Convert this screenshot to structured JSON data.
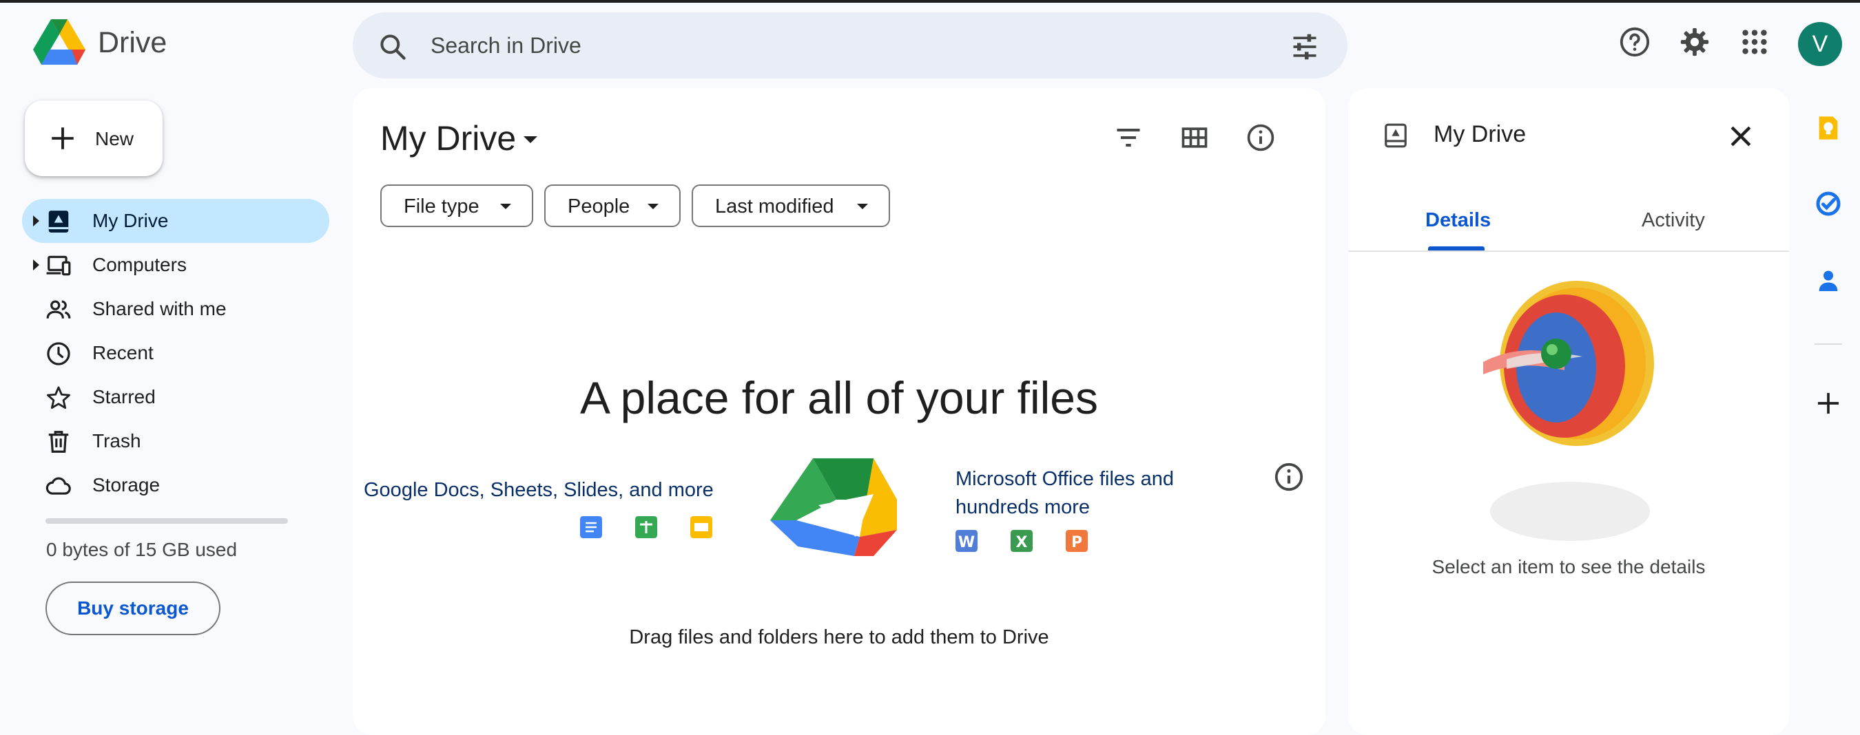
{
  "app": {
    "name": "Drive"
  },
  "search": {
    "placeholder": "Search in Drive"
  },
  "header": {
    "avatar_initial": "V"
  },
  "sidebar": {
    "new_label": "New",
    "items": [
      {
        "label": "My Drive",
        "icon": "my-drive-icon",
        "active": true,
        "expandable": true
      },
      {
        "label": "Computers",
        "icon": "computers-icon",
        "active": false,
        "expandable": true
      },
      {
        "label": "Shared with me",
        "icon": "shared-icon",
        "active": false,
        "expandable": false
      },
      {
        "label": "Recent",
        "icon": "clock-icon",
        "active": false,
        "expandable": false
      },
      {
        "label": "Starred",
        "icon": "star-icon",
        "active": false,
        "expandable": false
      },
      {
        "label": "Trash",
        "icon": "trash-icon",
        "active": false,
        "expandable": false
      },
      {
        "label": "Storage",
        "icon": "cloud-icon",
        "active": false,
        "expandable": false
      }
    ],
    "storage_used_fraction": 0,
    "storage_text": "0 bytes of 15 GB used",
    "buy_storage_label": "Buy storage"
  },
  "main": {
    "title": "My Drive",
    "filters": [
      "File type",
      "People",
      "Last modified"
    ],
    "empty_title": "A place for all of your files",
    "left_caption": "Google Docs, Sheets, Slides, and more",
    "right_caption_line1": "Microsoft Office files and",
    "right_caption_line2": "hundreds more",
    "office_letters": [
      "W",
      "X",
      "P"
    ],
    "drag_text": "Drag files and folders here to add them to Drive"
  },
  "details": {
    "title": "My Drive",
    "tabs": [
      "Details",
      "Activity"
    ],
    "active_tab": "Details",
    "hint": "Select an item to see the details"
  },
  "colors": {
    "accent": "#0b57d0",
    "active_nav": "#c2e7ff",
    "background": "#f8fafd",
    "avatar": "#0f7f6c"
  }
}
